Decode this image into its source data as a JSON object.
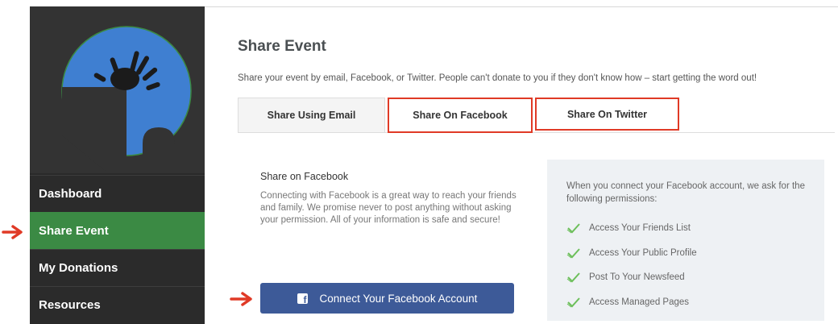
{
  "sidebar": {
    "logo_alt": "hand-print-logo",
    "items": [
      {
        "label": "Dashboard",
        "active": false
      },
      {
        "label": "Share Event",
        "active": true
      },
      {
        "label": "My Donations",
        "active": false
      },
      {
        "label": "Resources",
        "active": false
      }
    ]
  },
  "main": {
    "title": "Share Event",
    "subtitle": "Share your event by email, Facebook, or Twitter. People can't donate to you if they don't know how – start getting the word out!",
    "tabs": [
      {
        "label": "Share Using Email"
      },
      {
        "label": "Share On Facebook"
      },
      {
        "label": "Share On Twitter"
      }
    ]
  },
  "facebook": {
    "heading": "Share on Facebook",
    "description": "Connecting with Facebook is a great way to reach your friends and family. We promise never to post anything without asking your permission. All of your information is safe and secure!",
    "connect_label": "Connect Your Facebook Account",
    "icon_letter": "f"
  },
  "permissions": {
    "intro": "When you connect your Facebook account, we ask for the following permissions:",
    "items": [
      "Access Your Friends List",
      "Access Your Public Profile",
      "Post To Your Newsfeed",
      "Access Managed Pages"
    ]
  },
  "colors": {
    "sidebar_bg": "#2a2a2a",
    "active_nav": "#3b8a44",
    "facebook_blue": "#3d5a98",
    "highlight_red": "#e03a26",
    "check_green": "#6cbf5a",
    "logo_blue": "#3f7fd1"
  }
}
